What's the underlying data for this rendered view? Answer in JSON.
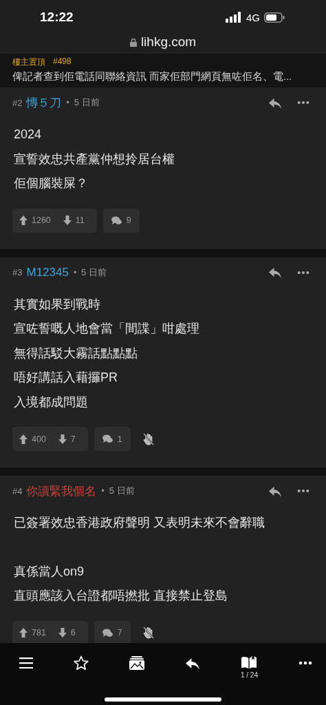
{
  "status_bar": {
    "time": "12:22",
    "network": "4G"
  },
  "address_bar": {
    "url": "lihkg.com"
  },
  "pinned": {
    "label": "樓主置頂",
    "ref": "#498",
    "text": "俾記者查到佢電話同聯絡資訊 而家佢部門網頁無咗佢名、電..."
  },
  "posts": [
    {
      "number": "#2",
      "author": "慱５刀",
      "color": "#3fa3d6",
      "separator": "•",
      "time": "5 日前",
      "lines": [
        {
          "text": "2024",
          "gap_before": false
        },
        {
          "text": "宣誓效忠共產黨仲想拎居台權",
          "gap_before": false
        },
        {
          "text": "佢個腦裝屎？",
          "gap_before": false
        }
      ],
      "upvotes": "1260",
      "downvotes": "11",
      "replies": "9",
      "block_button": false
    },
    {
      "number": "#3",
      "author": "M12345",
      "color": "#3fa3d6",
      "separator": "•",
      "time": "5 日前",
      "lines": [
        {
          "text": "其實如果到戰時",
          "gap_before": false
        },
        {
          "text": "宣咗誓嘅人地會當「間諜」咁處理",
          "gap_before": false
        },
        {
          "text": "無得話駁大霧話點點點",
          "gap_before": false
        },
        {
          "text": "唔好講話入藉攞PR",
          "gap_before": false
        },
        {
          "text": "入境都成問題",
          "gap_before": false
        }
      ],
      "upvotes": "400",
      "downvotes": "7",
      "replies": "1",
      "block_button": true
    },
    {
      "number": "#4",
      "author": "你讀緊我個名",
      "color": "#c8403a",
      "separator": "•",
      "time": "5 日前",
      "lines": [
        {
          "text": "已簽署效忠香港政府聲明 又表明未來不會辭職",
          "gap_before": false
        },
        {
          "text": "真係當人on9",
          "gap_before": true
        },
        {
          "text": "直頭應該入台證都唔撚批 直接禁止登島",
          "gap_before": false
        }
      ],
      "upvotes": "781",
      "downvotes": "6",
      "replies": "7",
      "block_button": true
    }
  ],
  "bottom_bar": {
    "page": "1 / 24"
  }
}
